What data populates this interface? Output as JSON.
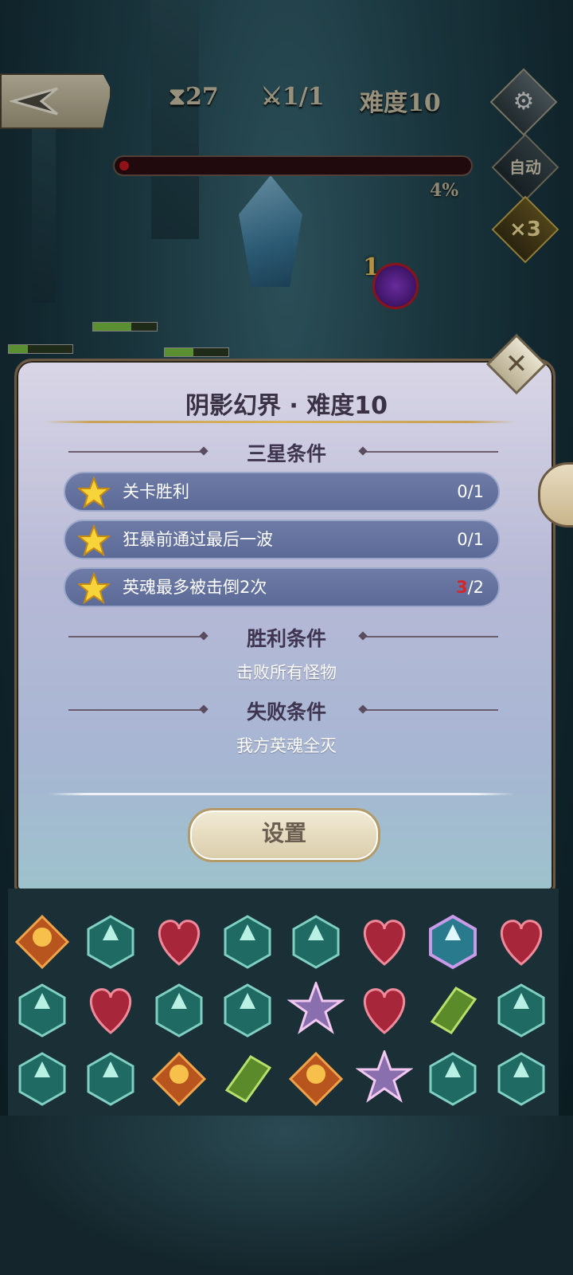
{
  "hud": {
    "timer_icon": "hourglass-icon",
    "timer": "27",
    "kills_icon": "crossed-swords-icon",
    "kills": "1/1",
    "difficulty": "难度10",
    "progress_percent": "4%",
    "auto_label": "自动",
    "speed_label": "×3",
    "wave_number": "1"
  },
  "modal": {
    "title": "阴影幻界 · 难度10",
    "three_star_heading": "三星条件",
    "conditions": [
      {
        "label": "关卡胜利",
        "current": "0",
        "total": "/1",
        "failed": false
      },
      {
        "label": "狂暴前通过最后一波",
        "current": "0",
        "total": "/1",
        "failed": false
      },
      {
        "label": "英魂最多被击倒2次",
        "current": "3",
        "total": "/2",
        "failed": true
      }
    ],
    "victory_heading": "胜利条件",
    "victory_text": "击败所有怪物",
    "defeat_heading": "失败条件",
    "defeat_text": "我方英魂全灭",
    "settings_button": "设置",
    "close_icon": "close-icon"
  },
  "colors": {
    "accent_gold": "#c7a255",
    "fail_red": "#d6262c",
    "panel_bottom": "#9dc2cc"
  },
  "board": {
    "rows": [
      [
        "fire",
        "arrow",
        "heart",
        "arrow",
        "arrow",
        "heart",
        "arrow-glow",
        "heart"
      ],
      [
        "arrow",
        "heart",
        "arrow",
        "arrow",
        "star",
        "heart",
        "leaf",
        "arrow"
      ],
      [
        "arrow",
        "arrow",
        "fire",
        "leaf",
        "fire",
        "star",
        "arrow",
        "arrow"
      ]
    ]
  }
}
